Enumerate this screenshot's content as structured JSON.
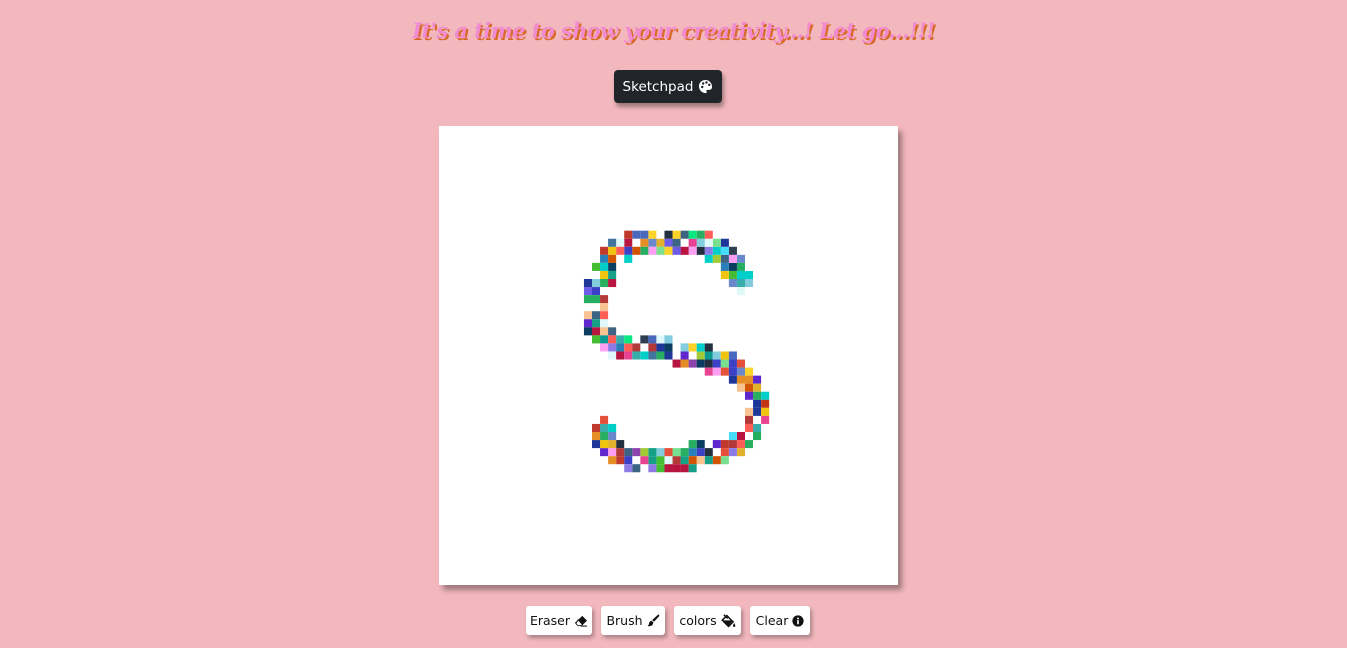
{
  "header": {
    "headline": "It's a time to show your creativity...! Let go...!!!"
  },
  "title_button": {
    "label": "Sketchpad",
    "icon": "palette-icon"
  },
  "sketch": {
    "background": "#ffffff",
    "grid_size": 57,
    "stroke_shape": "S",
    "palette": [
      "#c0392b",
      "#8e44ad",
      "#2980b9",
      "#27ae60",
      "#16a085",
      "#d35400",
      "#f1c40f",
      "#2c3e50",
      "#e84393",
      "#00cec9",
      "#6c5ce7",
      "#a3cb38",
      "#b33939",
      "#1e3799",
      "#78e08f",
      "#e58e26",
      "#82ccdd",
      "#3c6382",
      "#b71540",
      "#0a3d62",
      "#38ada9",
      "#f8c291",
      "#6a89cc",
      "#4a69bd",
      "#e55039",
      "#079992",
      "#ff5e57",
      "#0be881",
      "#3c40c6",
      "#ffd32a",
      "#8c7ae6",
      "#44bd32",
      "#c23616",
      "#40739e",
      "#e1b12c",
      "#dff9fb",
      "#5f27cd",
      "#222f3e",
      "#ff9ff3",
      "#48dbfb"
    ]
  },
  "toolbar": {
    "eraser_label": "Eraser",
    "brush_label": "Brush",
    "colors_label": "colors",
    "clear_label": "Clear"
  }
}
